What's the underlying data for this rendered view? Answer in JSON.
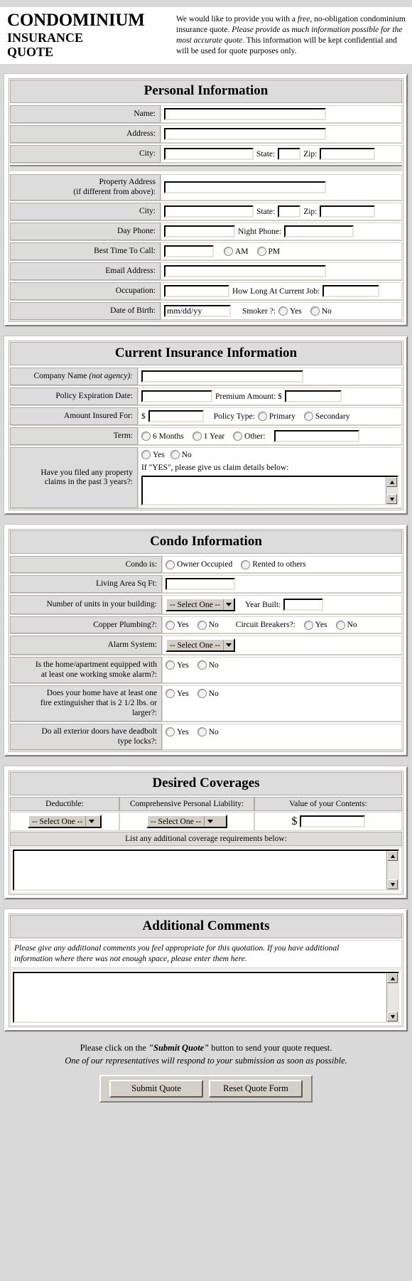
{
  "header": {
    "title_line1": "CONDOMINIUM",
    "title_line2": "INSURANCE",
    "title_line3": "QUOTE",
    "blurb_1": "We would like to provide you with a ",
    "blurb_free": "free",
    "blurb_2": ", no-obligation condominium insurance quote. ",
    "blurb_em": "Please provide as much information possible for the most accurate quote",
    "blurb_3": ". This information will be kept confidential and will be used for quote purposes only."
  },
  "personal": {
    "title": "Personal Information",
    "name_label": "Name:",
    "address_label": "Address:",
    "city_label": "City:",
    "state_label": "State:",
    "zip_label": "Zip:",
    "property_address_label_l1": "Property Address",
    "property_address_label_l2": "(if different from above):",
    "city2_label": "City:",
    "state2_label": "State:",
    "zip2_label": "Zip:",
    "day_phone_label": "Day Phone:",
    "night_phone_label": "Night Phone:",
    "best_time_label": "Best Time To Call:",
    "am_label": "AM",
    "pm_label": "PM",
    "email_label": "Email Address:",
    "occupation_label": "Occupation:",
    "how_long_job_label": "How Long At Current Job:",
    "dob_label": "Date of Birth:",
    "dob_value": "mm/dd/yy",
    "smoker_label": "Smoker ?:",
    "smoker_yes": "Yes",
    "smoker_no": "No"
  },
  "current_insurance": {
    "title": "Current Insurance Information",
    "company_label_main": "Company Name ",
    "company_label_em": "(not agency):",
    "policy_exp_label": "Policy Expiration Date:",
    "premium_label": "Premium Amount: $",
    "amount_insured_label": "Amount Insured For:",
    "dollar_sign": "$",
    "policy_type_label": "Policy Type:",
    "policy_primary": "Primary",
    "policy_secondary": "Secondary",
    "term_label": "Term:",
    "term_6months": "6 Months",
    "term_1year": "1 Year",
    "term_other": "Other:",
    "claims_label_l1": "Have you filed any property",
    "claims_label_l2": "claims in the past 3 years?:",
    "claims_yes": "Yes",
    "claims_no": "No",
    "claims_details_note": "If \"YES\", please give us claim details below:"
  },
  "condo": {
    "title": "Condo Information",
    "condo_is_label": "Condo is:",
    "owner_occupied": "Owner Occupied",
    "rented_to_others": "Rented to others",
    "living_area_label": "Living Area Sq Ft:",
    "units_label": "Number of units in your building:",
    "units_select": "-- Select One --",
    "year_built_label": "Year Built:",
    "copper_label": "Copper Plumbing?:",
    "copper_yes": "Yes",
    "copper_no": "No",
    "breakers_label": "Circuit Breakers?:",
    "breakers_yes": "Yes",
    "breakers_no": "No",
    "alarm_label": "Alarm System:",
    "alarm_select": "-- Select One --",
    "smoke_label_l1": "Is the home/apartment equipped with",
    "smoke_label_l2": "at least one working smoke alarm?:",
    "smoke_yes": "Yes",
    "smoke_no": "No",
    "fire_ext_label_l1": "Does your home have at least one",
    "fire_ext_label_l2": "fire extinguisher that is 2 1/2 lbs. or",
    "fire_ext_label_l3": "larger?:",
    "fire_yes": "Yes",
    "fire_no": "No",
    "deadbolt_label_l1": "Do all exterior doors have deadbolt",
    "deadbolt_label_l2": "type locks?:",
    "deadbolt_yes": "Yes",
    "deadbolt_no": "No"
  },
  "coverages": {
    "title": "Desired Coverages",
    "deductible_header": "Deductible:",
    "liability_header": "Comprehensive Personal Liability:",
    "contents_header": "Value of your Contents:",
    "deductible_select": "-- Select One --",
    "liability_select": "-- Select One --",
    "contents_dollar": "$",
    "additional_note": "List any additional coverage requirements below:"
  },
  "comments": {
    "title": "Additional Comments",
    "note_l1": "Please give any additional comments you feel appropriate for this quotation. If you have additional",
    "note_l2": "information where there was not enough space, please enter them here."
  },
  "footer": {
    "line1_a": "Please click on the ",
    "line1_b": "\"Submit Quote\"",
    "line1_c": " button to send your quote request.",
    "line2": "One of our representatives will respond to your submission as soon as possible.",
    "submit_label": "Submit Quote",
    "reset_label": "Reset Quote Form"
  }
}
